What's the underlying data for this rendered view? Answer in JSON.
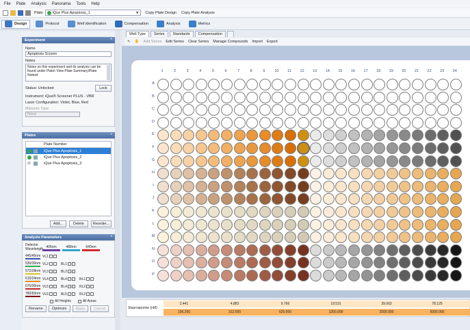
{
  "menu": [
    "File",
    "Plate",
    "Analysis",
    "Panorama",
    "Tools",
    "Help"
  ],
  "platebar": {
    "plate_label": "Plate",
    "plate_value": "iQue Plus Apoptosis_1",
    "copy_design": "Copy Plate Design",
    "copy_analysis": "Copy Plate Analysis"
  },
  "modules": [
    "Design",
    "Protocol",
    "Well Identification",
    "Compensation",
    "Analysis",
    "Metrics"
  ],
  "experiment": {
    "header": "Experiment",
    "name_label": "Name",
    "name_value": "Apoptosis Screen",
    "notes_label": "Notes",
    "notes_value": "Notes on this experiment and its analysis can be found under Plate\\ View Plate Summary\\Plate Notes#",
    "status_label": "Status: Unlocked",
    "lock_button": "Lock",
    "instrument": "Instrument: iQue® Screener PLUS - VBR",
    "laser": "Laser Configuration: Violet, Blue, Red",
    "mixtures_type_label": "Mixtures Type",
    "mixtures_type_value": "None"
  },
  "plates": {
    "header": "Plates",
    "col_header": "Plate Number",
    "items": [
      "iQue Plus Apoptosis_1",
      "iQue Plus Apoptosis_2",
      "iQue Plus Apoptosis_3"
    ],
    "add": "Add...",
    "delete": "Delete",
    "reorder": "Reorder..."
  },
  "analysis_params": {
    "header": "Analysis Parameters",
    "detector_label": "Detector Wavelength",
    "lasers": [
      "405nm",
      "488nm",
      "640nm"
    ],
    "laser_colors": [
      "#6b3fa0",
      "#2fa6d8",
      "#d42a2a"
    ],
    "bands": [
      {
        "label": "445/45nm",
        "color": "#3b4fb0",
        "channels": [
          "VL1"
        ]
      },
      {
        "label": "530/30nm",
        "color": "#2fae4f",
        "channels": [
          "VL2",
          "BL1"
        ]
      },
      {
        "label": "572/28nm",
        "color": "#d8c62a",
        "channels": [
          "VL3",
          "BL2"
        ]
      },
      {
        "label": "615/24nm",
        "color": "#e08a1f",
        "channels": [
          "VL4",
          "BL4",
          "RL1"
        ]
      },
      {
        "label": "675/30nm",
        "color": "#c72525",
        "channels": [
          "VL5",
          "BL4",
          "RL2"
        ]
      },
      {
        "label": "780/60nm",
        "color": "#7a1111",
        "channels": [
          "VL6",
          "BL5",
          "RL2"
        ]
      }
    ],
    "all_heights": "All Heights",
    "all_areas": "All Areas",
    "buttons": [
      "Rename",
      "Optimize",
      "Apply",
      "Cancel"
    ]
  },
  "subtabs": [
    "Well Type",
    "Series",
    "Standards",
    "Compensation"
  ],
  "plate_toolbar": [
    "Add Series",
    "Edit Series",
    "Clear Series",
    "Manage Compounds",
    "Import",
    "Export"
  ],
  "plate": {
    "columns": [
      "1",
      "2",
      "3",
      "4",
      "5",
      "6",
      "7",
      "8",
      "9",
      "10",
      "11",
      "12",
      "13",
      "14",
      "15",
      "16",
      "17",
      "18",
      "19",
      "20",
      "21",
      "22",
      "23",
      "24"
    ],
    "rows": [
      "A",
      "B",
      "C",
      "D",
      "E",
      "F",
      "G",
      "H",
      "I",
      "J",
      "K",
      "L",
      "M",
      "N",
      "O",
      "P"
    ]
  },
  "bottom": {
    "label": "Staurosporine (nM)",
    "row1": [
      "2.441",
      "4.883",
      "9.766",
      "19.531",
      "39.063",
      "78.125"
    ],
    "row2": [
      "156.250",
      "312.500",
      "625.000",
      "1250.000",
      "2500.000",
      "5000.000"
    ]
  }
}
